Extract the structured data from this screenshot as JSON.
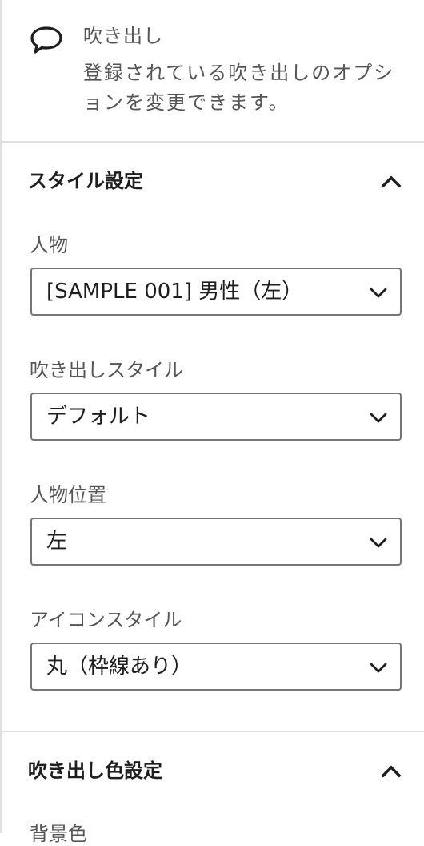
{
  "block": {
    "title": "吹き出し",
    "description": "登録されている吹き出しのオプションを変更できます。",
    "icon": "speech-bubble-icon"
  },
  "style_section": {
    "title": "スタイル設定",
    "toggle_icon": "chevron-up-icon",
    "fields": [
      {
        "label": "人物",
        "value": "[SAMPLE 001] 男性（左）"
      },
      {
        "label": "吹き出しスタイル",
        "value": "デフォルト"
      },
      {
        "label": "人物位置",
        "value": "左"
      },
      {
        "label": "アイコンスタイル",
        "value": "丸（枠線あり）"
      }
    ]
  },
  "color_section": {
    "title": "吹き出し色設定",
    "toggle_icon": "chevron-up-icon",
    "first_label": "背景色"
  }
}
